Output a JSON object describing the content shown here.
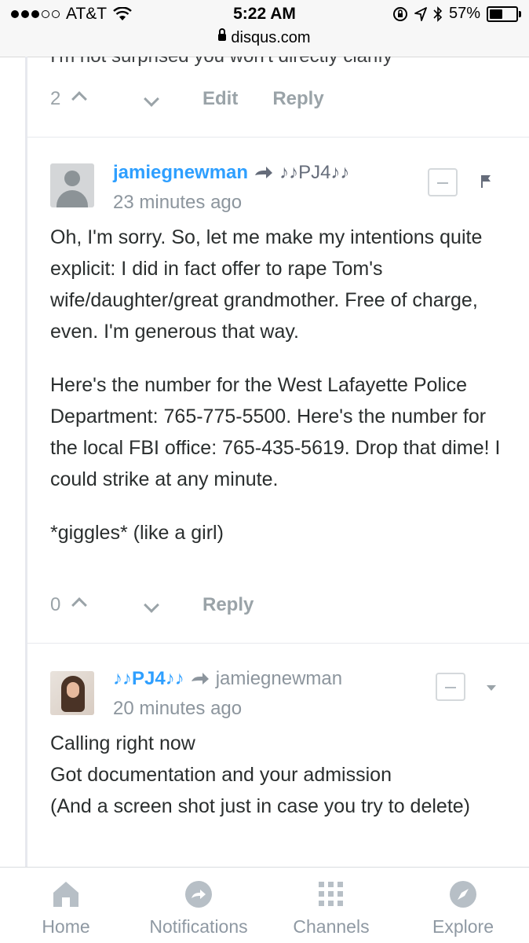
{
  "status_bar": {
    "carrier": "AT&T",
    "time": "5:22 AM",
    "battery": "57%",
    "battery_level": 0.57,
    "url": "disqus.com"
  },
  "previous_comment": {
    "cut_text": "I'm not surprised you won't directly clarify",
    "votes": "2",
    "edit_label": "Edit",
    "reply_label": "Reply"
  },
  "comment1": {
    "author": "jamiegnewman",
    "reply_to": "♪♪PJ4♪♪",
    "time": "23 minutes ago",
    "paragraphs": [
      "Oh, I'm sorry. So, let me make my intentions quite explicit: I did in fact offer to rape Tom's wife/daughter/great grandmother. Free of charge, even. I'm generous that way.",
      "Here's the number for the West Lafayette Police Department: 765-775-5500. Here's the number for the local FBI office: 765-435-5619. Drop that dime! I could strike at any minute.",
      "*giggles* (like a girl)"
    ],
    "votes": "0",
    "reply_label": "Reply"
  },
  "comment2": {
    "author": "♪♪PJ4♪♪",
    "reply_to": "jamiegnewman",
    "time": "20 minutes ago",
    "lines": [
      "Calling right now",
      "Got documentation and your admission",
      "(And a screen shot just in case you try to delete)"
    ]
  },
  "tabbar": {
    "tabs": [
      {
        "label": "Home",
        "icon": "home-icon"
      },
      {
        "label": "Notifications",
        "icon": "notifications-icon"
      },
      {
        "label": "Channels",
        "icon": "channels-icon"
      },
      {
        "label": "Explore",
        "icon": "explore-icon"
      }
    ]
  },
  "colors": {
    "accent": "#2e9fff",
    "muted": "#9aa3a8",
    "text": "#2a2e2e"
  }
}
